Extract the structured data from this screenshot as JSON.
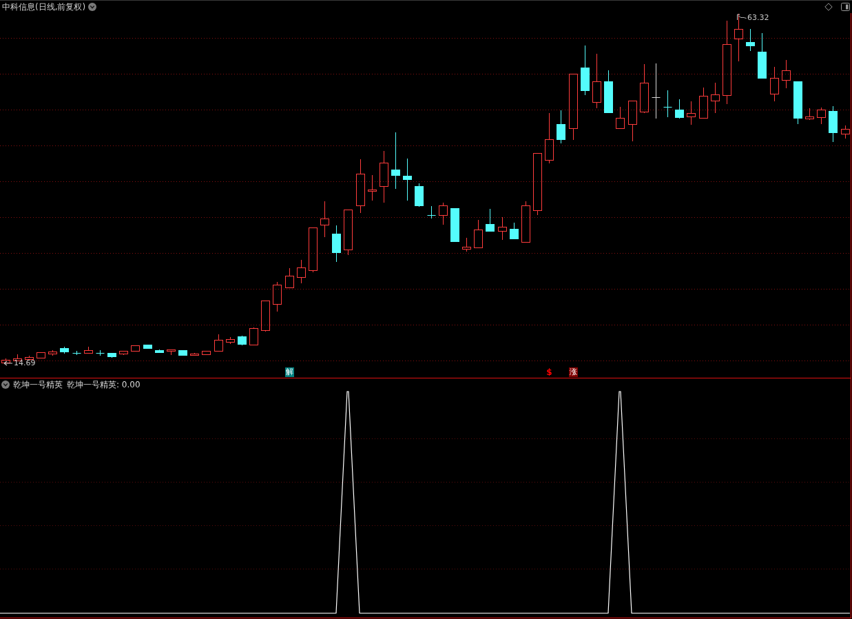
{
  "window": {
    "title": "中科信息(日线,前复权)"
  },
  "price_chart": {
    "high_label": "63.32",
    "low_label": "14.69",
    "signals": [
      {
        "kind": "tag",
        "text": "解",
        "color": "#008080"
      },
      {
        "kind": "glyph",
        "text": "$",
        "color": "#ff0000"
      },
      {
        "kind": "tag",
        "text": "涨",
        "color": "#800000"
      }
    ]
  },
  "indicator": {
    "title": "乾坤一号精英",
    "legend": "乾坤一号精英: 0.00"
  }
}
